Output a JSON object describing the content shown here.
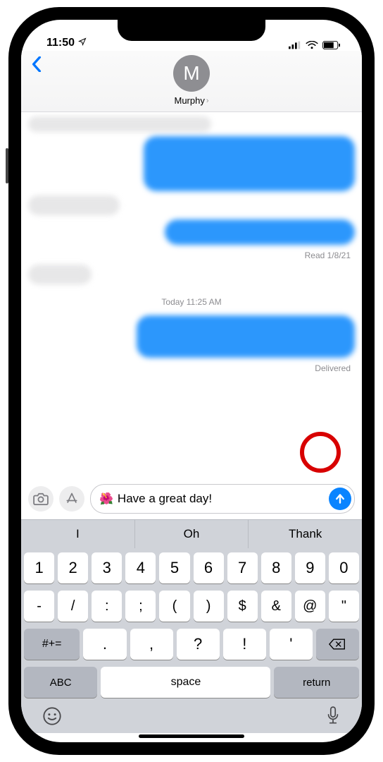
{
  "statusbar": {
    "time": "11:50"
  },
  "header": {
    "back_icon": "chevron-left",
    "contact_initial": "M",
    "contact_name": "Murphy"
  },
  "thread": {
    "read_status": "Read 1/8/21",
    "timestamp": "Today 11:25 AM",
    "delivered_status": "Delivered"
  },
  "compose": {
    "emoji": "🌺",
    "text": "Have a great day!"
  },
  "suggestions": [
    "I",
    "Oh",
    "Thank"
  ],
  "keyboard": {
    "row1": [
      "1",
      "2",
      "3",
      "4",
      "5",
      "6",
      "7",
      "8",
      "9",
      "0"
    ],
    "row2": [
      "-",
      "/",
      ":",
      ";",
      "(",
      ")",
      "$",
      "&",
      "@",
      "\""
    ],
    "row3_shift": "#+=",
    "row3": [
      ".",
      ",",
      "?",
      "!",
      "'"
    ],
    "row4_abc": "ABC",
    "row4_space": "space",
    "row4_return": "return"
  }
}
